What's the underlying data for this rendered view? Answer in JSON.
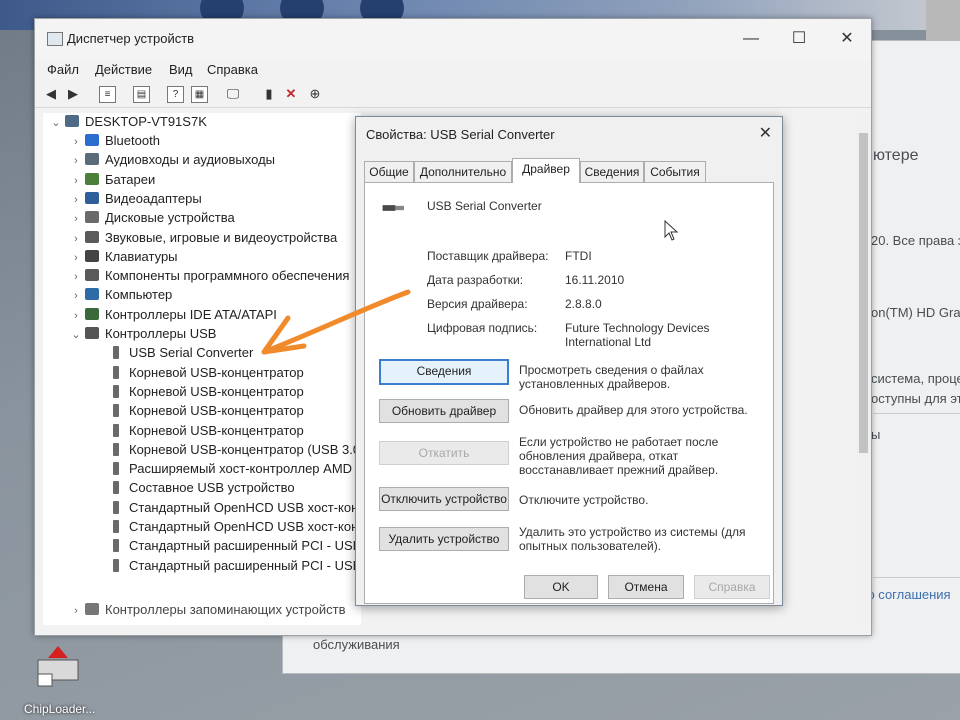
{
  "desktop": {
    "icon_label": "ChipLoader..."
  },
  "background_window": {
    "lines": [
      {
        "text": "ютере"
      },
      {
        "text": "20. Все права за"
      },
      {
        "text": "on(TM) HD Grap"
      },
      {
        "text": "система, проце"
      },
      {
        "text": "оступны для это"
      },
      {
        "text": "ы"
      },
      {
        "text": "го соглашения"
      }
    ],
    "bottom_text": "обслуживания"
  },
  "device_manager": {
    "title": "Диспетчер устройств",
    "window_buttons": {
      "minimize": "—",
      "maximize": "☐",
      "close": "✕"
    },
    "menu": [
      "Файл",
      "Действие",
      "Вид",
      "Справка"
    ],
    "tree": {
      "root": "DESKTOP-VT91S7K",
      "categories": [
        {
          "label": "Bluetooth",
          "color": "#2a6fd0"
        },
        {
          "label": "Аудиовходы и аудиовыходы",
          "color": "#5a6b7a"
        },
        {
          "label": "Батареи",
          "color": "#4b7f3a"
        },
        {
          "label": "Видеоадаптеры",
          "color": "#2f5f9a"
        },
        {
          "label": "Дисковые устройства",
          "color": "#6a6a6a"
        },
        {
          "label": "Звуковые, игровые и видеоустройства",
          "color": "#5a5a5a"
        },
        {
          "label": "Клавиатуры",
          "color": "#444444"
        },
        {
          "label": "Компоненты программного обеспечения",
          "color": "#5a5a5a"
        },
        {
          "label": "Компьютер",
          "color": "#2e6ca8"
        },
        {
          "label": "Контроллеры IDE ATA/ATAPI",
          "color": "#3a6a3a"
        },
        {
          "label": "Контроллеры USB",
          "color": "#555555"
        }
      ],
      "usb_children": [
        "USB Serial Converter",
        "Корневой USB-концентратор",
        "Корневой USB-концентратор",
        "Корневой USB-концентратор",
        "Корневой USB-концентратор",
        "Корневой USB-концентратор (USB 3.0)",
        "Расширяемый хост-контроллер AMD",
        "Составное USB устройство",
        "Стандартный OpenHCD USB хост-конт",
        "Стандартный OpenHCD USB хост-конт",
        "Стандартный расширенный PCI - USB",
        "Стандартный расширенный PCI - USB"
      ],
      "last_category": "Контроллеры запоминающих устройств"
    }
  },
  "properties_dialog": {
    "title": "Свойства: USB Serial Converter",
    "close": "✕",
    "tabs": [
      "Общие",
      "Дополнительно",
      "Драйвер",
      "Сведения",
      "События"
    ],
    "active_tab": "Драйвер",
    "device_name": "USB Serial Converter",
    "fields": [
      {
        "label": "Поставщик драйвера:",
        "value": "FTDI"
      },
      {
        "label": "Дата разработки:",
        "value": "16.11.2010"
      },
      {
        "label": "Версия драйвера:",
        "value": "2.8.8.0"
      },
      {
        "label": "Цифровая подпись:",
        "value": "Future Technology Devices International Ltd"
      }
    ],
    "actions": [
      {
        "button": "Сведения",
        "desc": "Просмотреть сведения о файлах установленных драйверов.",
        "state": "primary"
      },
      {
        "button": "Обновить драйвер",
        "desc": "Обновить драйвер для этого устройства.",
        "state": "normal"
      },
      {
        "button": "Откатить",
        "desc": "Если устройство не работает после обновления драйвера, откат восстанавливает прежний драйвер.",
        "state": "disabled"
      },
      {
        "button": "Отключить устройство",
        "desc": "Отключите устройство.",
        "state": "normal"
      },
      {
        "button": "Удалить устройство",
        "desc": "Удалить это устройство из системы (для опытных пользователей).",
        "state": "normal"
      }
    ],
    "footer": {
      "ok": "OK",
      "cancel": "Отмена",
      "help": "Справка"
    }
  },
  "colors": {
    "annotation_arrow": "#f08a2a",
    "primary_button_border": "#3c7fcf"
  }
}
